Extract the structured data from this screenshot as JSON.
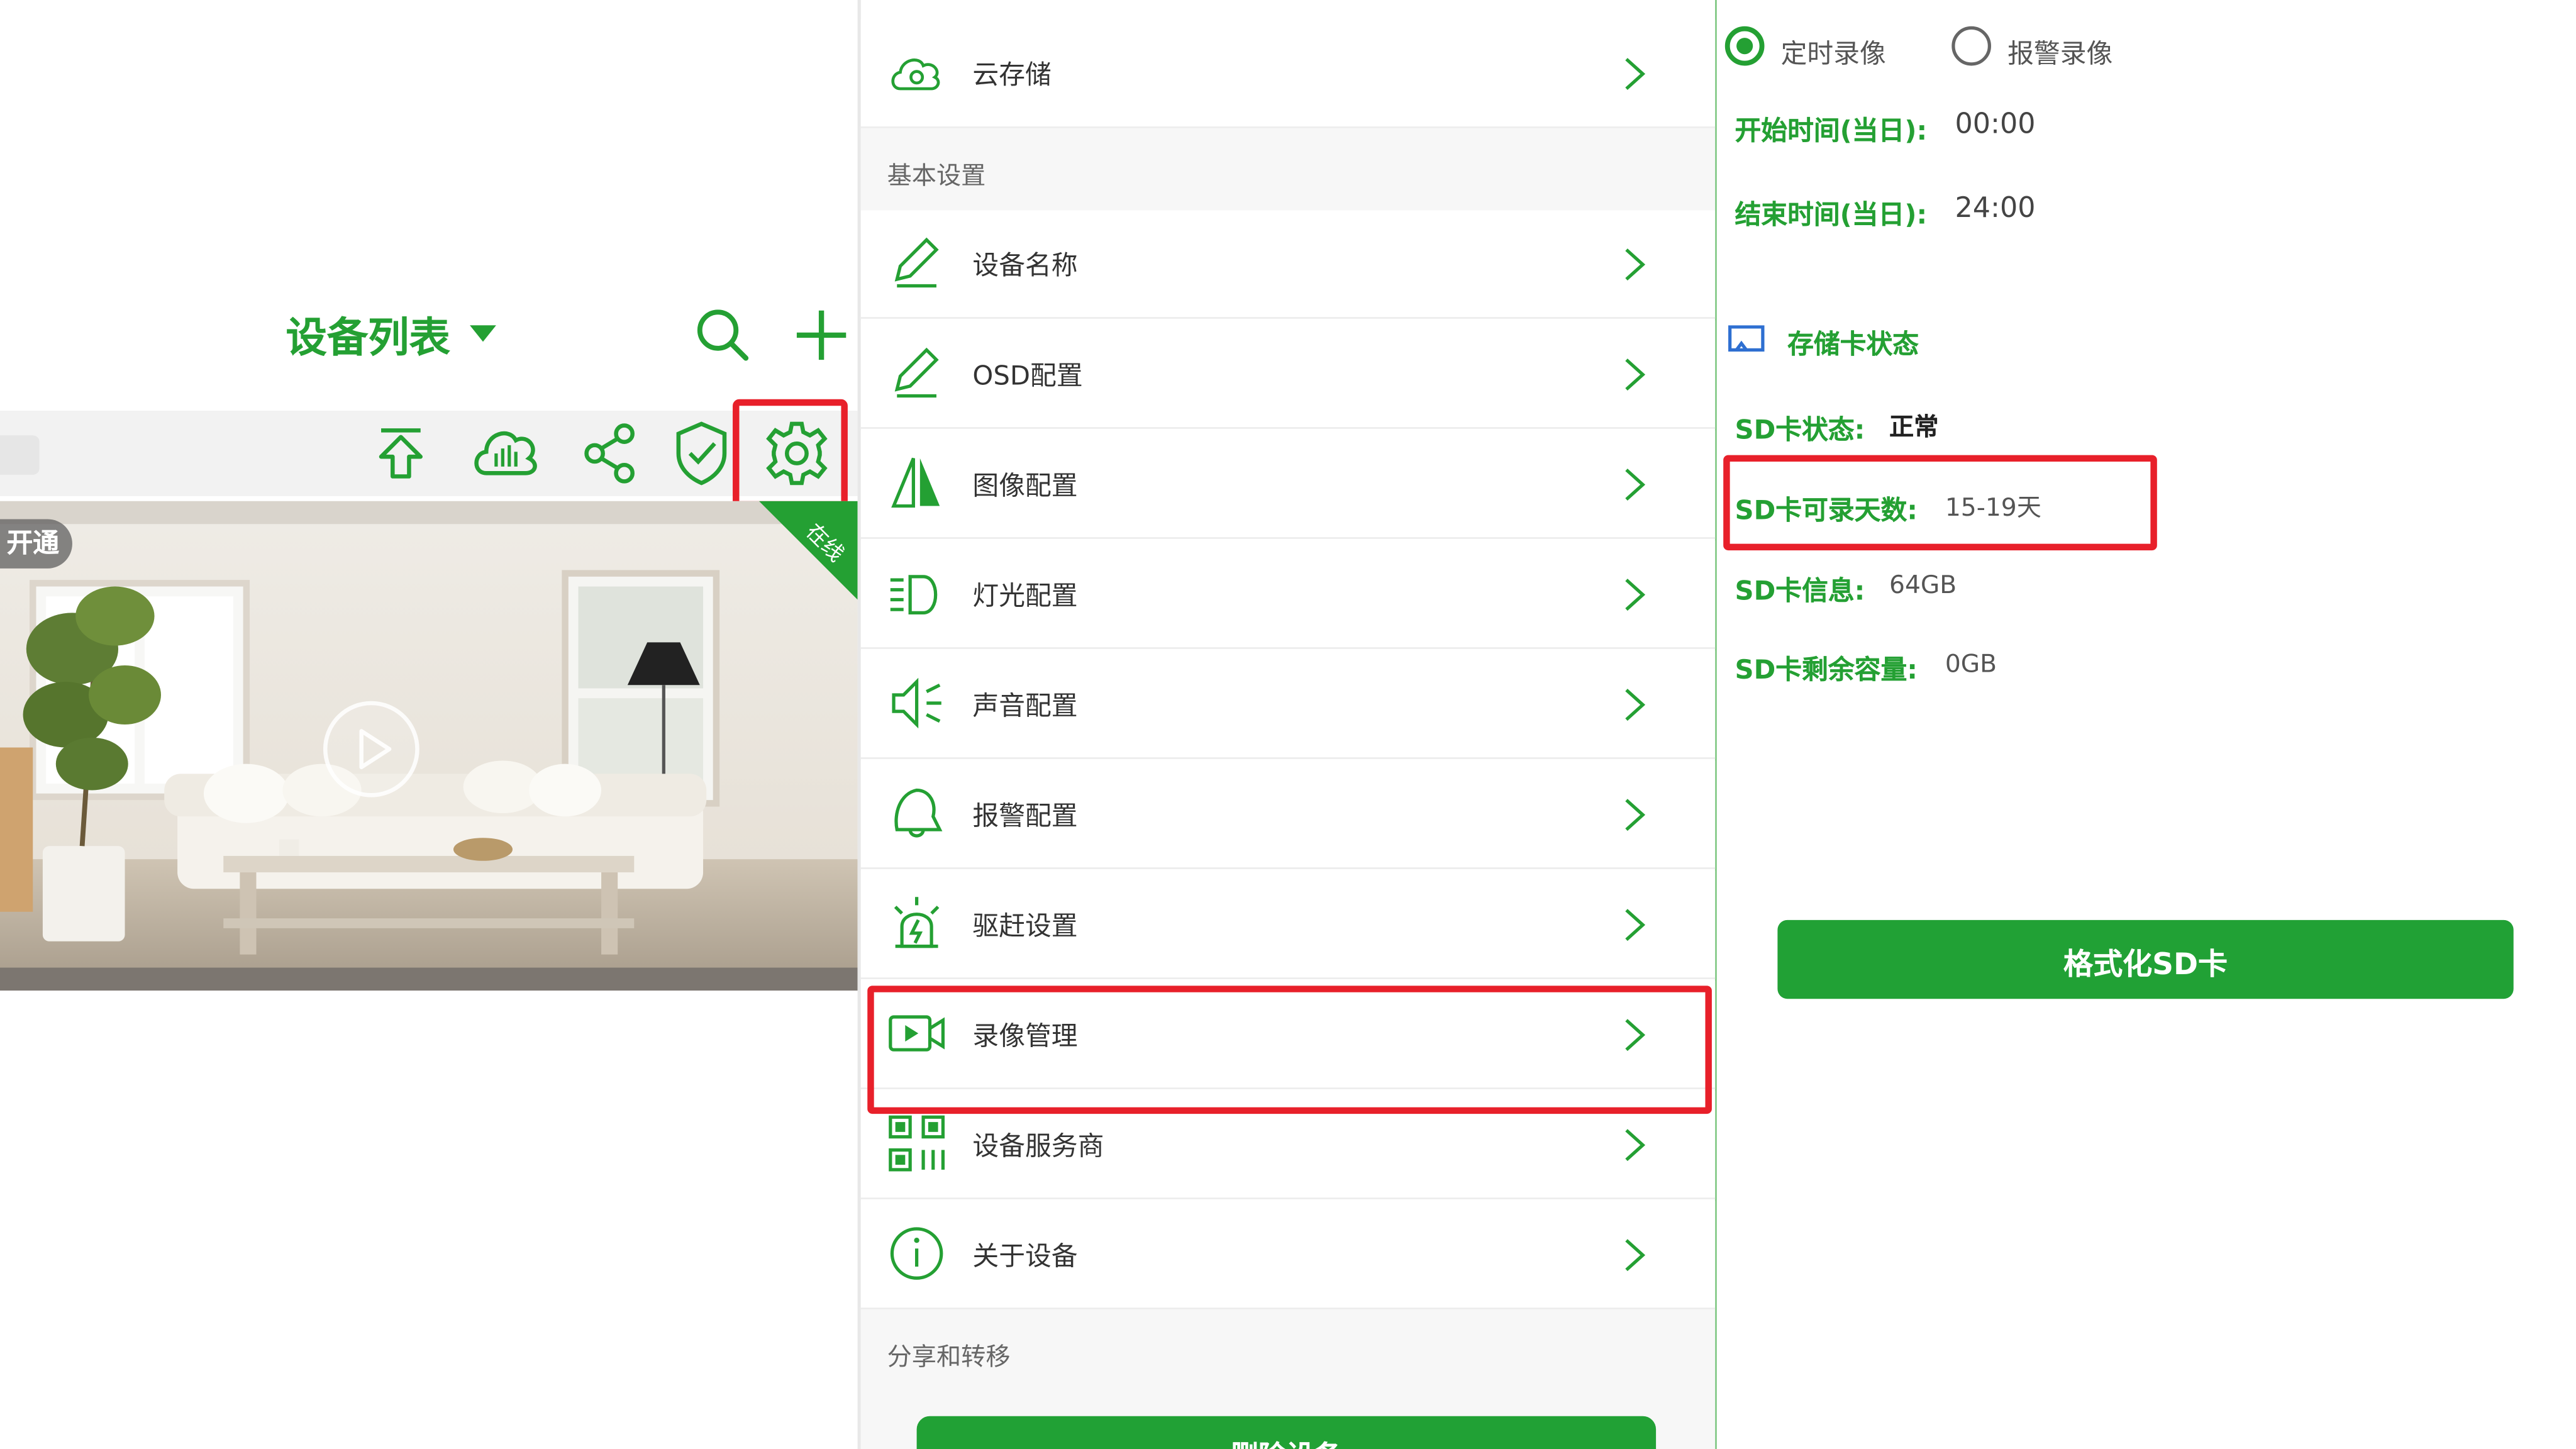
{
  "device_list": {
    "title": "设备列表",
    "badge_label": "开通",
    "online_label": "在线"
  },
  "settings_menu": {
    "cloud_storage": "云存储",
    "basic_section": "基本设置",
    "items": [
      {
        "label": "设备名称",
        "icon": "pencil-icon"
      },
      {
        "label": "OSD配置",
        "icon": "pencil-icon"
      },
      {
        "label": "图像配置",
        "icon": "image-config-icon"
      },
      {
        "label": "灯光配置",
        "icon": "light-icon"
      },
      {
        "label": "声音配置",
        "icon": "speaker-icon"
      },
      {
        "label": "报警配置",
        "icon": "alarm-icon"
      },
      {
        "label": "驱赶设置",
        "icon": "siren-icon"
      },
      {
        "label": "录像管理",
        "icon": "video-icon"
      },
      {
        "label": "设备服务商",
        "icon": "qr-icon"
      },
      {
        "label": "关于设备",
        "icon": "info-icon"
      }
    ],
    "share_section": "分享和转移",
    "delete_button": "删除设备"
  },
  "recording": {
    "mode_scheduled": "定时录像",
    "mode_alarm": "报警录像",
    "selected_mode": "定时录像",
    "start_time_label": "开始时间(当日):",
    "start_time": "00:00",
    "end_time_label": "结束时间(当日):",
    "end_time": "24:00",
    "storage_status_title": "存储卡状态",
    "sd_status_label": "SD卡状态:",
    "sd_status": "正常",
    "sd_days_label": "SD卡可录天数:",
    "sd_days": "15-19天",
    "sd_info_label": "SD卡信息:",
    "sd_info": "64GB",
    "sd_remaining_label": "SD卡剩余容量:",
    "sd_remaining": "0GB",
    "format_button": "格式化SD卡"
  },
  "colors": {
    "accent": "#24a033",
    "highlight": "#e8202a"
  }
}
